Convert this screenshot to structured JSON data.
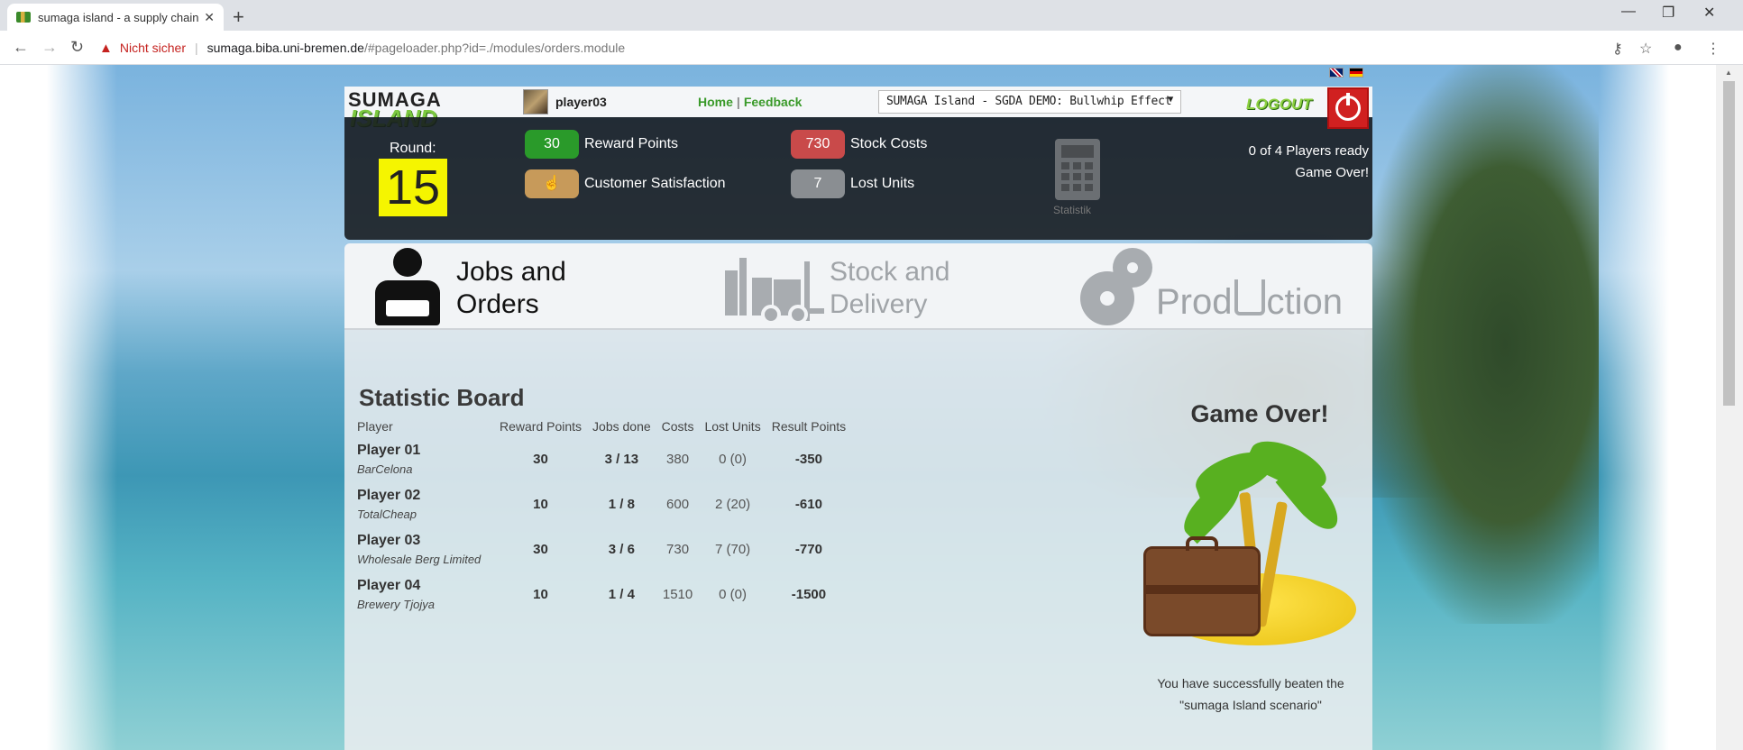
{
  "browser": {
    "tab_title": "sumaga island - a supply chain m",
    "tab_close": "✕",
    "new_tab": "+",
    "insecure_label": "Nicht sicher",
    "url_host": "sumaga.biba.uni-bremen.de",
    "url_path": "/#pageloader.php?id=./modules/orders.module",
    "icons": [
      "back-icon",
      "forward-icon",
      "reload-icon",
      "key-icon",
      "star-icon",
      "profile-icon",
      "menu-icon",
      "minimize-icon",
      "maximize-icon",
      "close-icon"
    ]
  },
  "header": {
    "logo_top": "SUMAGA",
    "logo_bottom": "ISLAND",
    "username": "player03",
    "home_link": "Home",
    "feedback_link": "Feedback",
    "link_separator": "|",
    "scenario_select": "SUMAGA Island - SGDA DEMO: Bullwhip Effect",
    "logout": "LOGOUT"
  },
  "status": {
    "round_label": "Round:",
    "round_value": "15",
    "reward_points_value": "30",
    "reward_points_label": "Reward Points",
    "customer_satisfaction_label": "Customer Satisfaction",
    "stock_costs_value": "730",
    "stock_costs_label": "Stock Costs",
    "lost_units_value": "7",
    "lost_units_label": "Lost Units",
    "statistik_label": "Statistik",
    "players_ready": "0 of 4 Players ready",
    "game_state": "Game Over!",
    "colors": {
      "reward": "#2a9a2a",
      "satisfaction": "#c79a5a",
      "stock": "#c94a4a",
      "lost": "#8a8e92",
      "round": "#f5f500"
    }
  },
  "modules": {
    "jobs_line1": "Jobs and",
    "jobs_line2": "Orders",
    "stock_line1": "Stock and",
    "stock_line2": "Delivery",
    "production_a": "Prod",
    "production_b": "ction"
  },
  "statistic_board": {
    "title": "Statistic Board",
    "columns": [
      "Player",
      "Reward Points",
      "Jobs done",
      "Costs",
      "Lost Units",
      "Result Points"
    ],
    "rows": [
      {
        "player": "Player 01",
        "company": "BarCelona",
        "reward": "30",
        "jobs": "3 / 13",
        "costs": "380",
        "lost": "0 (0)",
        "result": "-350"
      },
      {
        "player": "Player 02",
        "company": "TotalCheap",
        "reward": "10",
        "jobs": "1 / 8",
        "costs": "600",
        "lost": "2 (20)",
        "result": "-610"
      },
      {
        "player": "Player 03",
        "company": "Wholesale Berg Limited",
        "reward": "30",
        "jobs": "3 / 6",
        "costs": "730",
        "lost": "7 (70)",
        "result": "-770"
      },
      {
        "player": "Player 04",
        "company": "Brewery Tjojya",
        "reward": "10",
        "jobs": "1 / 4",
        "costs": "1510",
        "lost": "0 (0)",
        "result": "-1500"
      }
    ]
  },
  "game_over": {
    "title": "Game Over!",
    "message_line1": "You have successfully beaten the",
    "message_line2": "\"sumaga Island scenario\""
  }
}
